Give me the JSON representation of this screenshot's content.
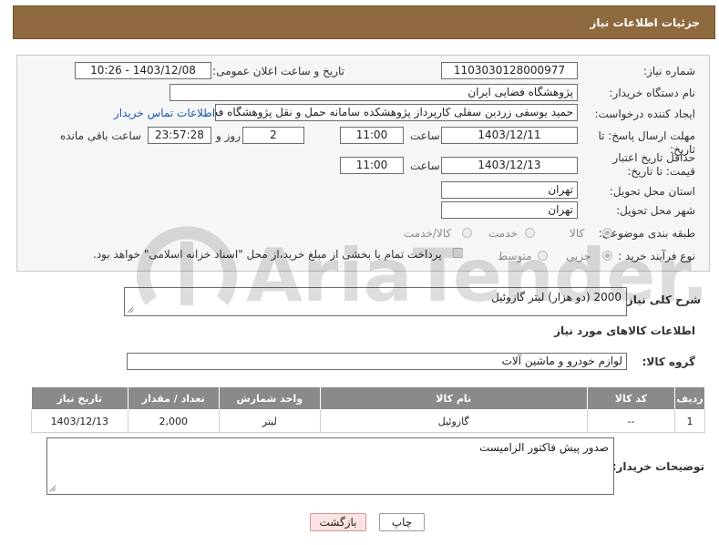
{
  "header": {
    "title": "جزئیات اطلاعات نیاز"
  },
  "form": {
    "need_number_label": "شماره نیاز:",
    "need_number": "1103030128000977",
    "announce_label": "تاریخ و ساعت اعلان عمومی:",
    "announce_value": "1403/12/08 - 10:26",
    "buyer_org_label": "نام دستگاه خریدار:",
    "buyer_org": "پژوهشگاه فضایی ایران",
    "creator_label": "ایجاد کننده درخواست:",
    "creator": "حمید یوسفی زردین سفلی کارپرداز پژوهشکده سامانه حمل و نقل پژوهشگاه فضایی ایران",
    "contact_link": "اطلاعات تماس خریدار",
    "send_deadline_label": "مهلت ارسال پاسخ: تا تاریخ:",
    "send_date": "1403/12/11",
    "time_label": "ساعت",
    "send_time": "11:00",
    "days": "2",
    "days_label": "روز و",
    "remaining_time": "23:57:28",
    "remaining_label": "ساعت باقی مانده",
    "validity_label": "حداقل تاریخ اعتبار قیمت: تا تاریخ:",
    "validity_date": "1403/12/13",
    "validity_time": "11:00",
    "province_label": "استان محل تحویل:",
    "province": "تهران",
    "city_label": "شهر محل تحویل:",
    "city": "تهران",
    "category_label": "طبقه بندی موضوعی:",
    "category_options": [
      "کالا",
      "خدمت",
      "کالا/خدمت"
    ],
    "process_label": "نوع فرآیند خرید :",
    "process_options": [
      "جزیی",
      "متوسط"
    ],
    "payment_note": "پرداخت تمام یا بخشی از مبلغ خرید،از محل \"اسناد خزانه اسلامی\" خواهد بود."
  },
  "summary": {
    "label": "شرح کلی نیاز:",
    "value": "2000 (دو هزار) لیتر گازوئیل"
  },
  "goods": {
    "section_title": "اطلاعات کالاهای مورد نیاز",
    "group_label": "گروه کالا:",
    "group_value": "لوازم خودرو و ماشین آلات",
    "columns": [
      "ردیف",
      "کد کالا",
      "نام کالا",
      "واحد شمارش",
      "تعداد / مقدار",
      "تاریخ نیاز"
    ],
    "rows": [
      [
        "1",
        "--",
        "گازوئیل",
        "لیتر",
        "2,000",
        "1403/12/13"
      ]
    ]
  },
  "buyer_notes": {
    "label": "توضیحات خریدار:",
    "value": "صدور پیش فاکتور الزامیست"
  },
  "buttons": {
    "print": "چاپ",
    "back": "بازگشت"
  },
  "watermark": {
    "text": "AriaTender.neT"
  }
}
